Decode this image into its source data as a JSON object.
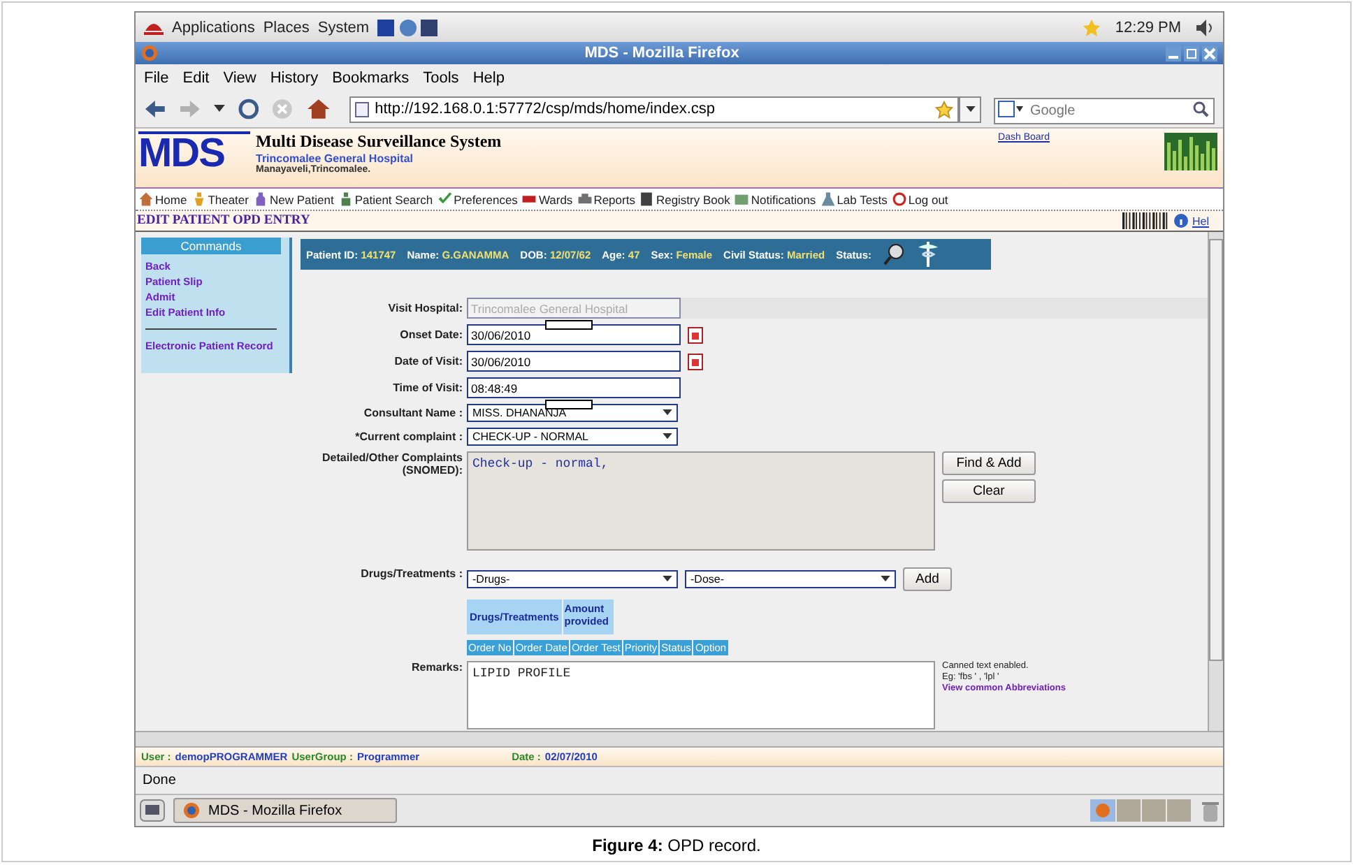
{
  "top_panel": {
    "menus": [
      "Applications",
      "Places",
      "System"
    ],
    "clock": "12:29 PM"
  },
  "window": {
    "title": "MDS - Mozilla Firefox"
  },
  "menu_bar": [
    "File",
    "Edit",
    "View",
    "History",
    "Bookmarks",
    "Tools",
    "Help"
  ],
  "address_bar": {
    "url": "http://192.168.0.1:57772/csp/mds/home/index.csp"
  },
  "search": {
    "placeholder": "Google"
  },
  "header": {
    "logo": "MDS",
    "title": "Multi Disease Surveillance System",
    "hospital": "Trincomalee General Hospital",
    "address": "Manayaveli,Trincomalee.",
    "link": "Dash Board"
  },
  "nav": [
    "Home",
    "Theater",
    "New Patient",
    "Patient Search",
    "Preferences",
    "Wards",
    "Reports",
    "Registry Book",
    "Notifications",
    "Lab Tests",
    "Log out"
  ],
  "page_title": "EDIT PATIENT OPD ENTRY",
  "help_link": "Hel",
  "commands": {
    "title": "Commands",
    "items": [
      "Back",
      "Patient Slip",
      "Admit",
      "Edit Patient Info"
    ],
    "extra": "Electronic Patient Record"
  },
  "patient": {
    "fields": [
      {
        "label": "Patient ID:",
        "value": "141747"
      },
      {
        "label": "Name:",
        "value": "G.GANAMMA"
      },
      {
        "label": "DOB:",
        "value": "12/07/62"
      },
      {
        "label": "Age:",
        "value": "47"
      },
      {
        "label": "Sex:",
        "value": "Female"
      },
      {
        "label": "Civil Status:",
        "value": "Married"
      }
    ],
    "status_label": "Status:"
  },
  "form": {
    "fields": [
      {
        "kind": "text",
        "label": "Visit Hospital:",
        "value": "Trincomalee General Hospital",
        "disabled": true,
        "redacted": false
      },
      {
        "kind": "date",
        "label": "Onset Date:",
        "value": "30/06/2010",
        "disabled": false,
        "redacted": true
      },
      {
        "kind": "date",
        "label": "Date of Visit:",
        "value": "30/06/2010",
        "disabled": false,
        "redacted": false
      },
      {
        "kind": "text",
        "label": "Time of Visit:",
        "value": "08:48:49",
        "disabled": false,
        "redacted": false
      },
      {
        "kind": "select",
        "label": "Consultant Name :",
        "value": "MISS. DHANANJA",
        "disabled": false,
        "redacted": true
      },
      {
        "kind": "select",
        "label": "*Current complaint :",
        "value": "CHECK-UP - NORMAL",
        "disabled": false,
        "redacted": false
      }
    ],
    "complaints": {
      "label": "Detailed/Other Complaints (SNOMED):",
      "value": "Check-up - normal,",
      "buttons": [
        "Find & Add",
        "Clear"
      ]
    },
    "drugs": {
      "label": "Drugs/Treatments :",
      "drug_select": "-Drugs-",
      "dose_select": "-Dose-",
      "button": "Add",
      "columns": [
        "Drugs/Treatments",
        "Amount provided"
      ]
    },
    "orders": {
      "columns": [
        "Order No",
        "Order Date",
        "Order Test",
        "Priority",
        "Status",
        "Option"
      ]
    },
    "remarks": {
      "label": "Remarks:",
      "value": "LIPID PROFILE",
      "hints": [
        "Canned text enabled.",
        "Eg: 'fbs ' , 'lpl '"
      ],
      "link": "View common Abbreviations"
    }
  },
  "footer": {
    "user_label": "User :",
    "user": "demopPROGRAMMER",
    "group_label": "UserGroup :",
    "group": "Programmer",
    "date_label": "Date :",
    "date": "02/07/2010"
  },
  "status_bar": "Done",
  "taskbar": {
    "window": "MDS - Mozilla Firefox"
  },
  "caption": "**Figure 4:** OPD record."
}
